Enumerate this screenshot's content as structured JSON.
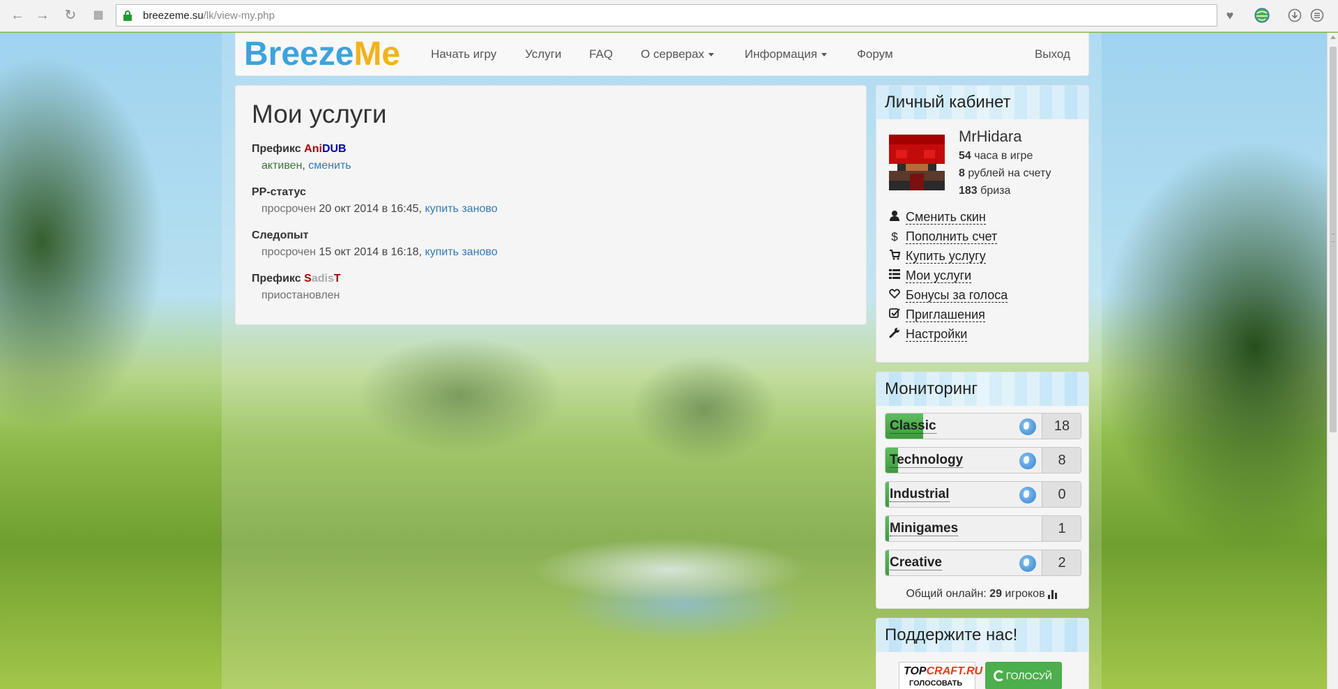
{
  "browser": {
    "url_host": "breezeme.su",
    "url_path": "/lk/view-my.php"
  },
  "navbar": {
    "brand_part1": "Breeze",
    "brand_part2": "Me",
    "links": [
      {
        "label": "Начать игру"
      },
      {
        "label": "Услуги"
      },
      {
        "label": "FAQ"
      },
      {
        "label": "О серверах",
        "dropdown": true
      },
      {
        "label": "Информация",
        "dropdown": true
      },
      {
        "label": "Форум"
      }
    ],
    "logout": "Выход"
  },
  "main": {
    "title": "Мои услуги",
    "services": [
      {
        "title_prefix": "Префикс ",
        "tag_part1": "Ani",
        "tag_part2": "DUB",
        "status": "активен",
        "separator": ", ",
        "action": "сменить"
      },
      {
        "title": "PP-статус",
        "status": "просрочен",
        "date": " 20 окт 2014 в 16:45, ",
        "action": "купить заново"
      },
      {
        "title": "Следопыт",
        "status": "просрочен",
        "date": " 15 окт 2014 в 16:18, ",
        "action": "купить заново"
      },
      {
        "title_prefix": "Префикс ",
        "tag_part1": "S",
        "tag_part2": "adis",
        "tag_part3": "T",
        "status": "приостановлен"
      }
    ]
  },
  "account": {
    "heading": "Личный кабинет",
    "username": "MrHidara",
    "hours_value": "54",
    "hours_label": " часа в игре",
    "balance_value": "8",
    "balance_label": " рублей на счету",
    "breeze_value": "183",
    "breeze_label": " бриза",
    "menu": [
      {
        "label": "Сменить скин",
        "icon": "user-icon"
      },
      {
        "label": "Пополнить счет",
        "icon": "dollar-icon"
      },
      {
        "label": "Купить услугу",
        "icon": "cart-icon"
      },
      {
        "label": "Мои услуги",
        "icon": "list-icon"
      },
      {
        "label": "Бонусы за голоса",
        "icon": "heart-icon"
      },
      {
        "label": "Приглашения",
        "icon": "check-square-icon"
      },
      {
        "label": "Настройки",
        "icon": "wrench-icon"
      }
    ]
  },
  "monitoring": {
    "heading": "Мониторинг",
    "servers": [
      {
        "name": "Classic",
        "players": "18",
        "load": 0.24,
        "globe": true
      },
      {
        "name": "Technology",
        "players": "8",
        "load": 0.08,
        "globe": true
      },
      {
        "name": "Industrial",
        "players": "0",
        "load": 0.0,
        "globe": true
      },
      {
        "name": "Minigames",
        "players": "1",
        "load": 0.01,
        "globe": false
      },
      {
        "name": "Creative",
        "players": "2",
        "load": 0.02,
        "globe": true
      }
    ],
    "online_label": "Общий онлайн: ",
    "online_count": "29",
    "online_suffix": " игроков"
  },
  "support": {
    "heading": "Поддержите нас!",
    "topcraft_part1": "TOP",
    "topcraft_part2": "CRAFT.RU",
    "topcraft_sub": "ГОЛОСОВАТЬ",
    "vote_label": "ГОЛОСУЙ"
  },
  "colors": {
    "accent_blue": "#3da3dc",
    "accent_yellow": "#f3b21c",
    "link": "#337ab7",
    "status_active": "#3c763d",
    "progress_green": "#4cae4c"
  }
}
